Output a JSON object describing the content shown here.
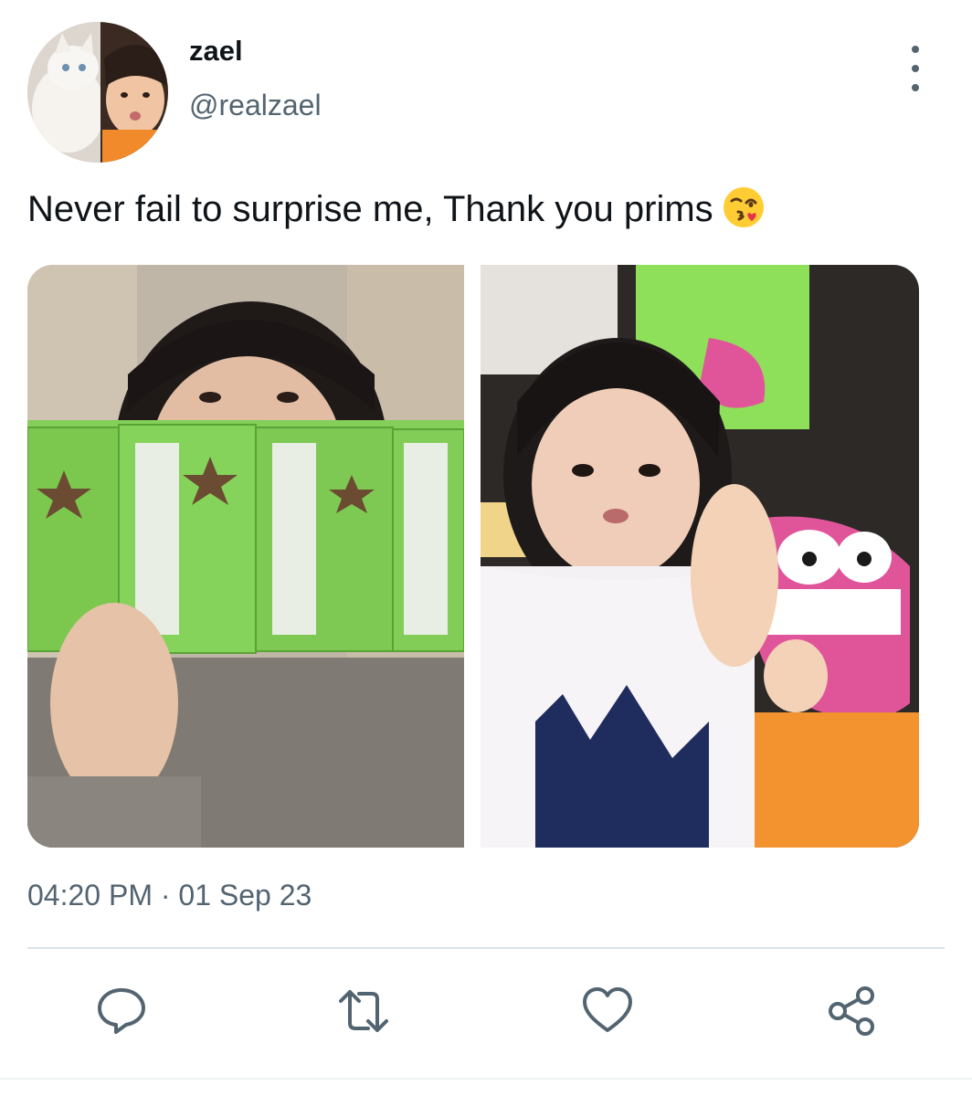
{
  "tweet": {
    "display_name": "zael",
    "handle": "@realzael",
    "text": "Never fail to surprise me, Thank you prims",
    "emoji": "face-throwing-kiss-emoji",
    "time": "04:20 PM",
    "separator": "·",
    "date": "01 Sep 23"
  },
  "actions": [
    {
      "name": "reply",
      "icon": "reply-icon"
    },
    {
      "name": "retweet",
      "icon": "retweet-icon"
    },
    {
      "name": "like",
      "icon": "heart-icon"
    },
    {
      "name": "share",
      "icon": "share-icon"
    }
  ],
  "colors": {
    "text_primary": "#0f1419",
    "text_secondary": "#536471",
    "divider": "#dde3e8",
    "snack_green": "#7ed04b",
    "plush_pink": "#e0559a"
  }
}
